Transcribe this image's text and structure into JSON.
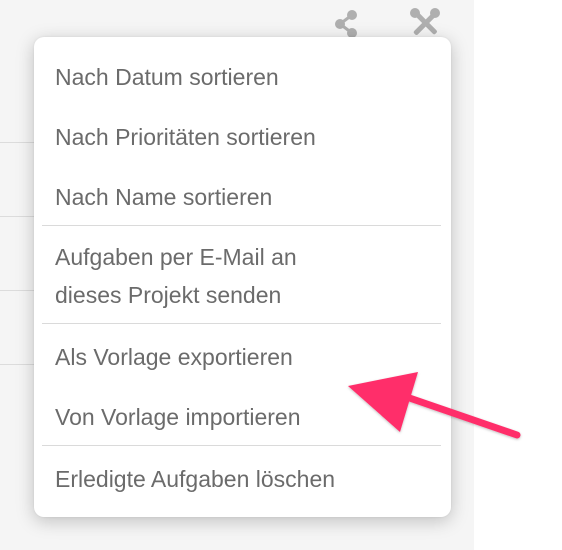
{
  "menu": {
    "items": [
      {
        "label": "Nach Datum sortieren"
      },
      {
        "label": "Nach Prioritäten sortieren"
      },
      {
        "label": "Nach Name sortieren"
      },
      {
        "label": "Aufgaben per E-Mail an"
      },
      {
        "label": "dieses Projekt senden"
      },
      {
        "label": "Als Vorlage exportieren"
      },
      {
        "label": "Von Vorlage importieren"
      },
      {
        "label": "Erledigte Aufgaben löschen"
      }
    ]
  },
  "icons": {
    "share": "share-icon",
    "tools": "tools-icon"
  },
  "colors": {
    "arrow": "#ff2f6b",
    "menu_text": "#6b6b6b",
    "backdrop": "#f5f5f5"
  }
}
